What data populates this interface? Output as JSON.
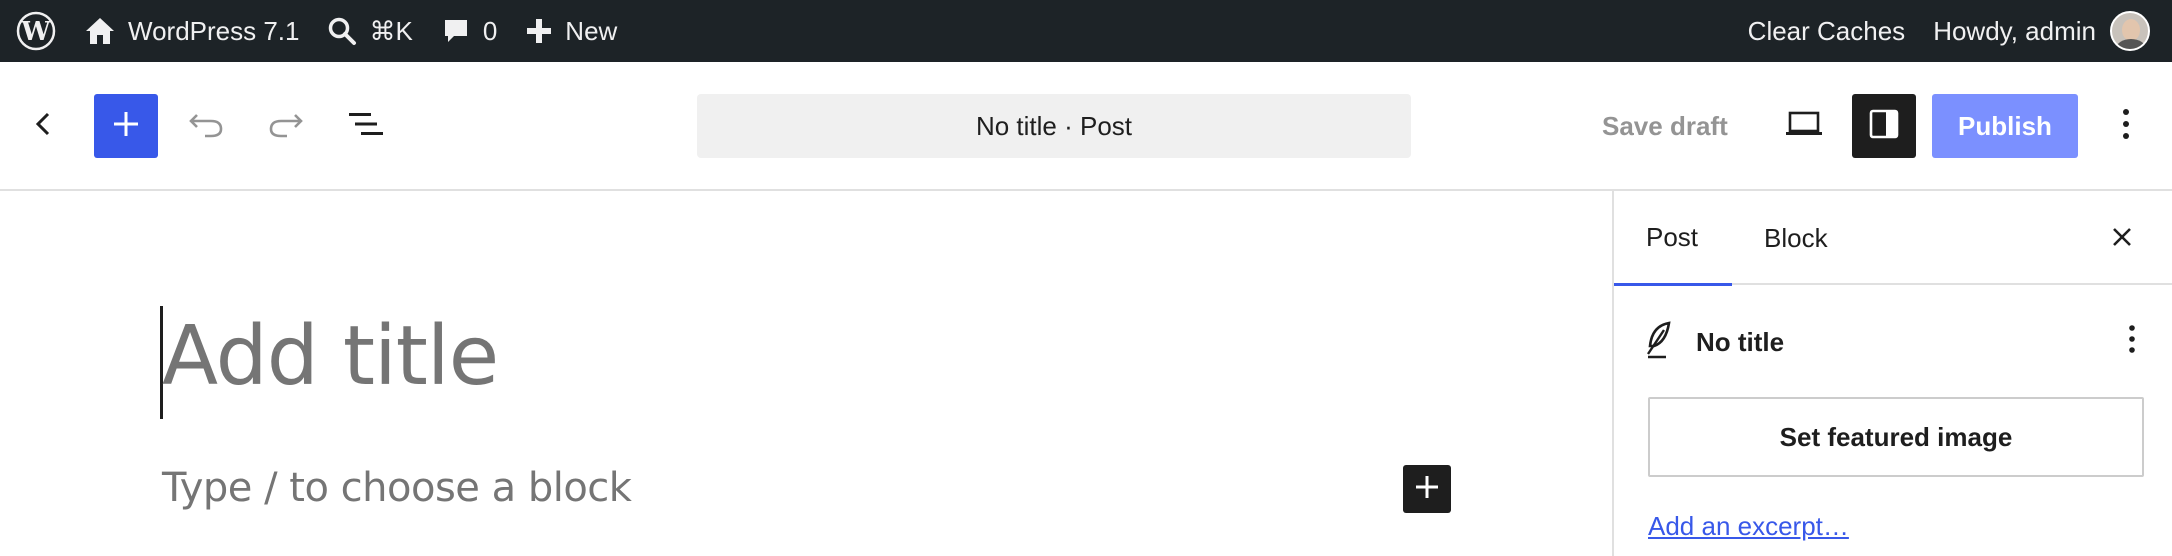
{
  "admin_bar": {
    "site_name": "WordPress 7.1",
    "search_shortcut": "⌘K",
    "comments_count": "0",
    "new_label": "New",
    "clear_caches": "Clear Caches",
    "greeting": "Howdy, admin"
  },
  "header": {
    "document_title": "No title · Post",
    "save_draft": "Save draft",
    "publish": "Publish"
  },
  "canvas": {
    "title_placeholder": "Add title",
    "block_placeholder": "Type / to choose a block"
  },
  "sidebar": {
    "tabs": [
      {
        "label": "Post",
        "active": true
      },
      {
        "label": "Block",
        "active": false
      }
    ],
    "post_title": "No title",
    "featured_image_button": "Set featured image",
    "excerpt_link": "Add an excerpt…"
  },
  "colors": {
    "admin_bar_bg": "#1d2327",
    "accent": "#3858e9",
    "publish_disabled": "#7b90ff",
    "placeholder_text": "#757575"
  }
}
